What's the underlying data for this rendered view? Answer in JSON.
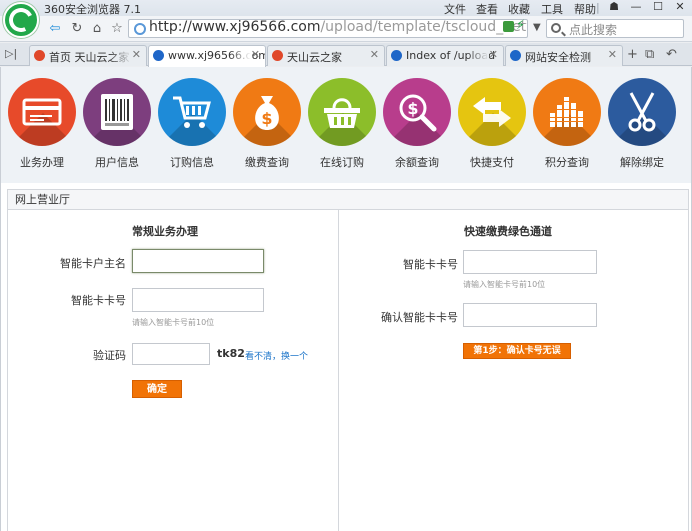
{
  "browser": {
    "name": "360安全浏览器 7.1",
    "menu": [
      "文件",
      "查看",
      "收藏",
      "工具",
      "帮助"
    ],
    "url_host": "http://www.xj96566.com",
    "url_path": "/upload/template/tscloud_netwo",
    "search_placeholder": "点此搜索",
    "tabs": [
      {
        "label": "首页 天山云之家",
        "active": false
      },
      {
        "label": "www.xj96566.com",
        "active": true
      },
      {
        "label": "天山云之家",
        "active": false
      },
      {
        "label": "Index of /upload",
        "active": false
      },
      {
        "label": "网站安全检测",
        "active": false
      }
    ]
  },
  "menu_items": [
    {
      "label": "业务办理",
      "icon": "card-icon",
      "color": "#e74a2a"
    },
    {
      "label": "用户信息",
      "icon": "barcode-icon",
      "color": "#7d3e7e"
    },
    {
      "label": "订购信息",
      "icon": "cart-icon",
      "color": "#1e8bd8"
    },
    {
      "label": "缴费查询",
      "icon": "money-bag-icon",
      "color": "#f07a14"
    },
    {
      "label": "在线订购",
      "icon": "basket-icon",
      "color": "#8cbe2a"
    },
    {
      "label": "余额查询",
      "icon": "magnifier-dollar-icon",
      "color": "#b83d8c"
    },
    {
      "label": "快捷支付",
      "icon": "arrows-icon",
      "color": "#e5c510"
    },
    {
      "label": "积分查询",
      "icon": "bars-icon",
      "color": "#f07a14"
    },
    {
      "label": "解除绑定",
      "icon": "scissors-icon",
      "color": "#2c5b9e"
    }
  ],
  "panel": {
    "title": "网上营业厅",
    "left": {
      "title": "常规业务办理",
      "owner_label": "智能卡户主名",
      "owner_value": "",
      "card_label": "智能卡卡号",
      "card_value": "",
      "card_hint": "请输入智能卡号前10位",
      "captcha_label": "验证码",
      "captcha_value": "",
      "captcha_code": "tk82",
      "refresh_link": "看不清，换一个",
      "submit": "确定"
    },
    "right": {
      "title": "快速缴费绿色通道",
      "card_label": "智能卡卡号",
      "card_value": "",
      "card_hint": "请输入智能卡号前10位",
      "confirm_label": "确认智能卡卡号",
      "confirm_value": "",
      "step_button": "第1步：确认卡号无误"
    }
  }
}
